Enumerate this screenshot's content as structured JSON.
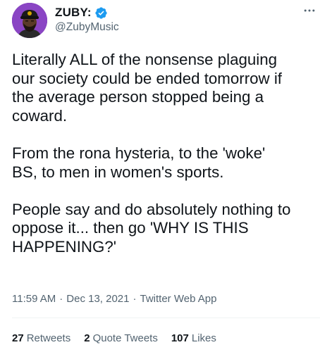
{
  "user": {
    "display_name": "ZUBY:",
    "handle": "@ZubyMusic",
    "verified": true
  },
  "tweet": {
    "text": "Literally ALL of the nonsense plaguing\nour society could be ended tomorrow if\nthe average person stopped being a\ncoward.\n\nFrom the rona hysteria, to the 'woke'\nBS, to men in women's sports.\n\nPeople say and do absolutely nothing to\noppose it... then go 'WHY IS THIS\nHAPPENING?'",
    "time": "11:59 AM",
    "separator": "·",
    "date": "Dec 13, 2021",
    "source": "Twitter Web App"
  },
  "stats": {
    "retweets_count": "27",
    "retweets_label": "Retweets",
    "quote_tweets_count": "2",
    "quote_tweets_label": "Quote Tweets",
    "likes_count": "107",
    "likes_label": "Likes"
  },
  "icons": {
    "more": "more-options-icon",
    "verified": "verified-badge-icon"
  },
  "colors": {
    "text": "#0f1419",
    "secondary": "#536471",
    "verified": "#1d9bf0",
    "divider": "#eff3f4",
    "avatar_bg": "#6a2fa0"
  }
}
